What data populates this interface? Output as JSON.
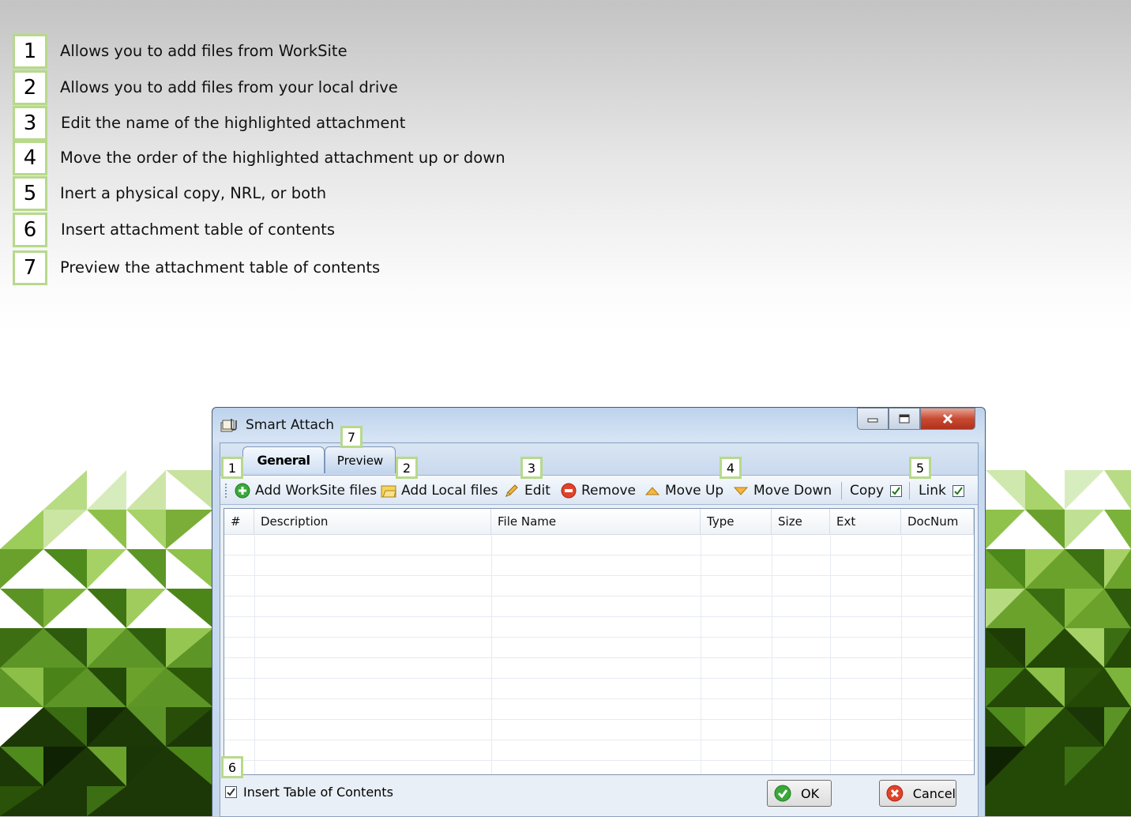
{
  "legend": [
    {
      "num": "1",
      "text": "Allows you to add files from WorkSite"
    },
    {
      "num": "2",
      "text": "Allows you to add files from your local drive"
    },
    {
      "num": "3",
      "text": "Edit the name of the highlighted attachment"
    },
    {
      "num": "4",
      "text": "Move the order of the highlighted attachment up or down"
    },
    {
      "num": "5",
      "text": "Inert a physical copy, NRL, or both"
    },
    {
      "num": "6",
      "text": "Insert attachment table of contents"
    },
    {
      "num": "7",
      "text": "Preview the attachment table of contents"
    }
  ],
  "window": {
    "title": "Smart Attach",
    "title_icon": "paperclip-attach-icon",
    "controls": {
      "minimize": "minimize-icon",
      "maximize": "maximize-icon",
      "close": "close-icon"
    }
  },
  "tabs": [
    {
      "label": "General",
      "active": true
    },
    {
      "label": "Preview",
      "active": false
    }
  ],
  "toolbar": {
    "add_worksite": {
      "label": "Add WorkSite files",
      "icon": "add-green-icon"
    },
    "add_local": {
      "label": "Add Local files",
      "icon": "folder-icon"
    },
    "edit": {
      "label": "Edit",
      "icon": "pencil-icon"
    },
    "remove": {
      "label": "Remove",
      "icon": "remove-red-icon"
    },
    "move_up": {
      "label": "Move Up",
      "icon": "arrow-up-icon"
    },
    "move_down": {
      "label": "Move Down",
      "icon": "arrow-down-icon"
    },
    "copy": {
      "label": "Copy",
      "checked": true
    },
    "link": {
      "label": "Link",
      "checked": true
    }
  },
  "grid": {
    "columns": [
      "#",
      "Description",
      "File Name",
      "Type",
      "Size",
      "Ext",
      "DocNum"
    ],
    "rows": []
  },
  "footer": {
    "insert_toc": {
      "label": "Insert Table of Contents",
      "checked": true
    },
    "ok": "OK",
    "cancel": "Cancel"
  },
  "callouts": {
    "c1": "1",
    "c2": "2",
    "c3": "3",
    "c4": "4",
    "c5": "5",
    "c6": "6",
    "c7": "7"
  },
  "colors": {
    "callout_border": "#b7d98b",
    "accent_green": "#5a9b2a",
    "window_frame": "#c6d8ee"
  }
}
